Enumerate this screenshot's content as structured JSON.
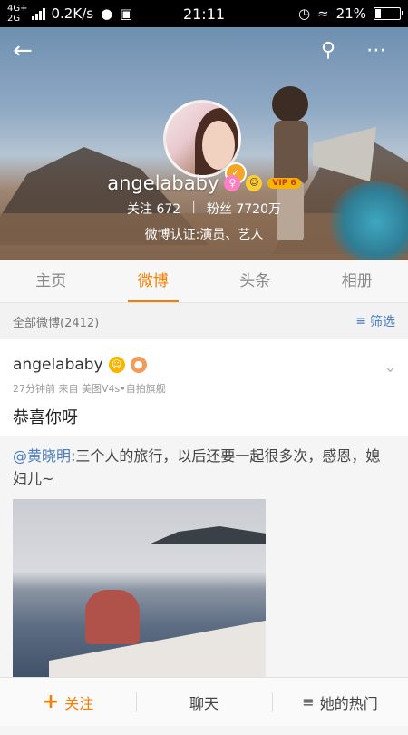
{
  "status_bar": {
    "network_top": "4G+",
    "network_bottom": "2G",
    "speed": "0.2K/s",
    "time": "21:11",
    "battery": "21%",
    "battery_level": 0.21,
    "icons": [
      "signal-icon",
      "wechat-icon",
      "sim-icon",
      "alarm-icon",
      "wifi-icon",
      "battery-icon"
    ]
  },
  "header": {
    "back_icon": "back-arrow-icon",
    "search_icon": "search-icon",
    "more_icon": "more-icon",
    "username": "angelababy",
    "vip_label": "VIP 6",
    "following_label": "关注",
    "following_count": "672",
    "followers_label": "粉丝",
    "followers_count": "7720万",
    "verification": "微博认证:演员、艺人"
  },
  "tabs": [
    {
      "label": "主页",
      "active": false
    },
    {
      "label": "微博",
      "active": true
    },
    {
      "label": "头条",
      "active": false
    },
    {
      "label": "相册",
      "active": false
    }
  ],
  "filter": {
    "label": "全部微博(2412)",
    "button": "筛选"
  },
  "post": {
    "author": "angelababy",
    "meta": "27分钟前  来自 美图V4s•自拍旗舰",
    "text": "恭喜你呀",
    "repost": {
      "mention": "@黄晓明",
      "text": ":三个人的旅行，以后还要一起很多次，感恩，媳妇儿~"
    }
  },
  "bottom_bar": {
    "follow": "关注",
    "chat": "聊天",
    "hot": "她的热门"
  },
  "colors": {
    "accent": "#fa7d00",
    "link": "#4a7ec3"
  }
}
